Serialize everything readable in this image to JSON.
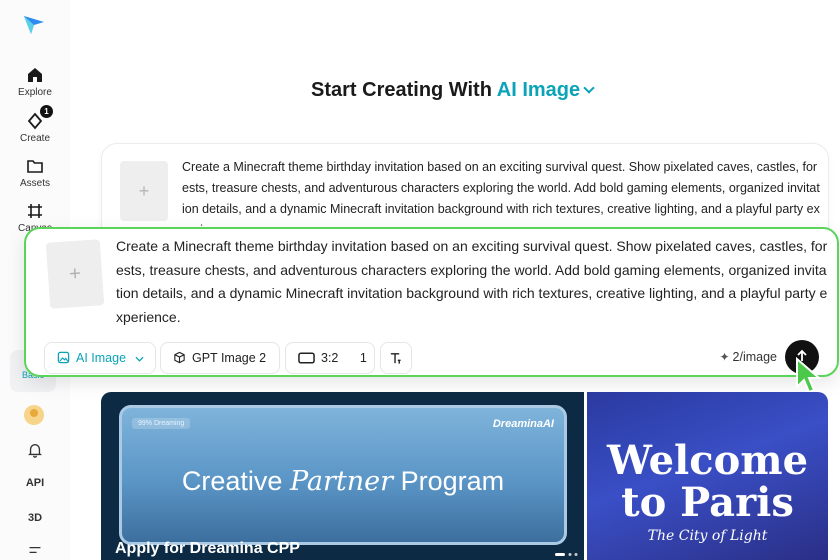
{
  "sidebar": {
    "items": [
      {
        "label": "Explore"
      },
      {
        "label": "Create",
        "badge": "1"
      },
      {
        "label": "Assets"
      },
      {
        "label": "Canvas"
      }
    ],
    "basic_label": "Basic",
    "api_label": "API",
    "threed_label": "3D"
  },
  "header": {
    "title": "Start Creating With",
    "accent": "AI Image"
  },
  "prompt": {
    "text": "Create a Minecraft theme birthday invitation based on an exciting survival quest. Show pixelated caves, castles, forests, treasure chests, and adventurous characters exploring the world. Add bold gaming elements, organized invitation details, and a dynamic Minecraft invitation background with rich textures, creative lighting, and a playful party experience."
  },
  "toolbar": {
    "mode": "AI Image",
    "model": "GPT Image 2",
    "ratio": "3:2",
    "count": "1",
    "cost": "2/image"
  },
  "banners": {
    "cpp_chip": "99% Dreaming",
    "cpp_brand": "DreaminaAI",
    "cpp_title_a": "Creative",
    "cpp_title_b": "Partner",
    "cpp_title_c": "Program",
    "cpp_sub": "Apply for Dreamina CPP",
    "paris_title": "Welcome to Paris",
    "paris_sub": "The City of Light"
  },
  "colors": {
    "accent": "#0aa3b8",
    "highlight_border": "#5bd45a"
  }
}
